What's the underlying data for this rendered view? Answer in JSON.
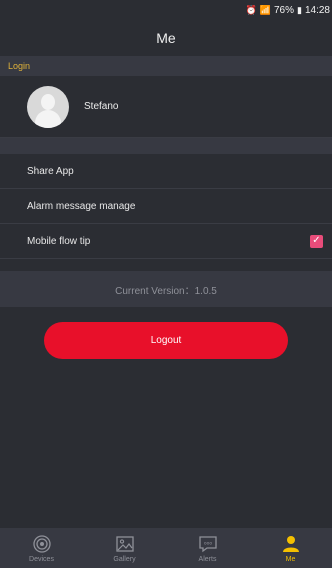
{
  "status_bar": {
    "battery": "76%",
    "time": "14:28"
  },
  "header": {
    "title": "Me"
  },
  "login_section": {
    "header": "Login",
    "user_name": "Stefano"
  },
  "menu": {
    "share_app": "Share App",
    "alarm_message_manage": "Alarm message manage",
    "mobile_flow_tip": "Mobile flow tip",
    "mobile_flow_tip_checked": true
  },
  "version": {
    "text": "Current Version：1.0.5"
  },
  "logout": {
    "label": "Logout"
  },
  "tabs": [
    {
      "label": "Devices",
      "icon": "devices-icon",
      "active": false
    },
    {
      "label": "Gallery",
      "icon": "gallery-icon",
      "active": false
    },
    {
      "label": "Alerts",
      "icon": "alerts-icon",
      "active": false
    },
    {
      "label": "Me",
      "icon": "me-icon",
      "active": true
    }
  ],
  "colors": {
    "accent": "#f5c000",
    "logout": "#e8102a",
    "checkbox": "#e84c7a"
  }
}
